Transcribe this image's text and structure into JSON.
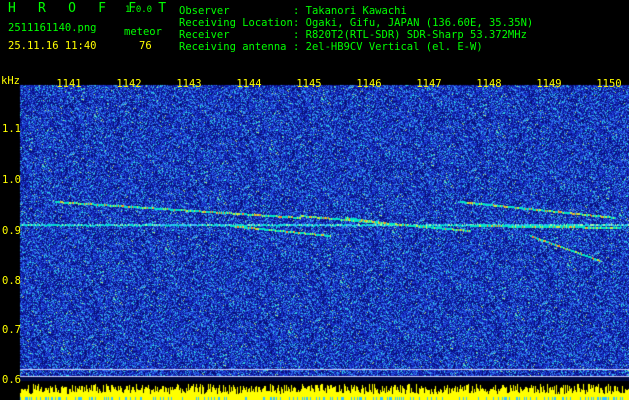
{
  "app": {
    "name": "H R O F F T",
    "version": "1.0.0"
  },
  "file": {
    "name": "2511161140.png",
    "datetime": "25.11.16 11:40"
  },
  "count": {
    "label": "meteor",
    "value": "76"
  },
  "info": {
    "labels": [
      "Observer",
      "Receiving Location",
      "Receiver",
      "Receiving antenna"
    ],
    "values": [
      ": Takanori Kawachi",
      ": Ogaki, Gifu, JAPAN (136.60E, 35.35N)",
      ": R820T2(RTL-SDR) SDR-Sharp 53.372MHz",
      ": 2el-HB9CV Vertical (el. E-W)"
    ]
  },
  "axes": {
    "y_unit": "kHz",
    "x_ticks": [
      "1141",
      "1142",
      "1143",
      "1144",
      "1145",
      "1146",
      "1147",
      "1148",
      "1149",
      "1150"
    ],
    "y_ticks": [
      "1.1",
      "1.0",
      "0.9",
      "0.8",
      "0.7",
      "0.6"
    ]
  },
  "colors": {
    "background": "#000000",
    "header_text": "#00ff00",
    "axis_text": "#ffff00",
    "noise": "#1a2fd0",
    "trace": "#00ffd0"
  }
}
